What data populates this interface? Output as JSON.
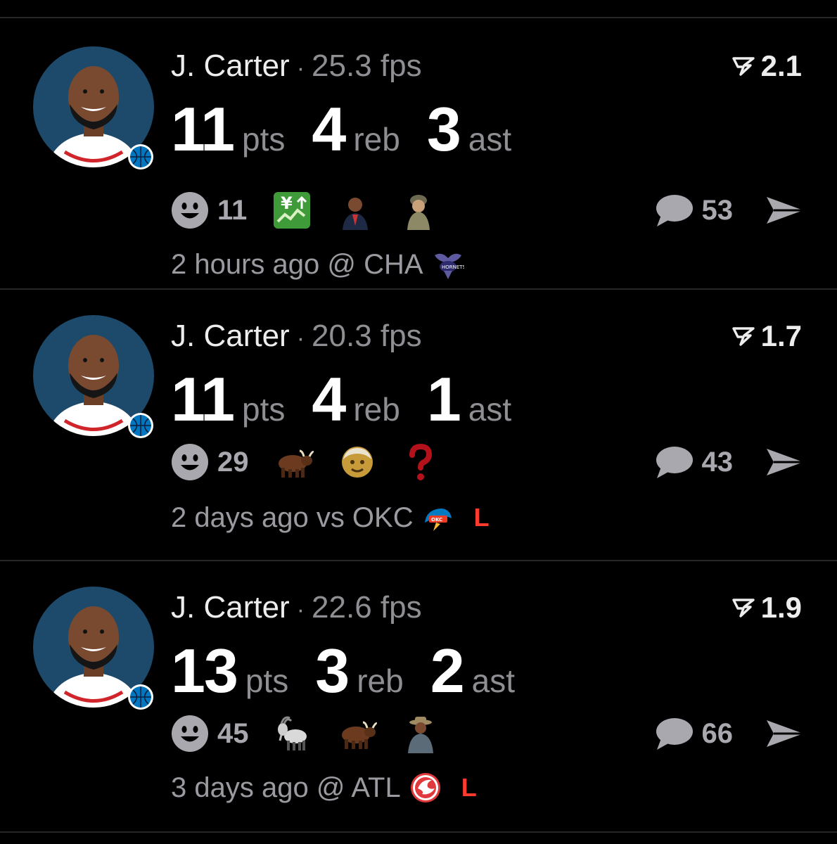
{
  "posts": [
    {
      "player": "J. Carter",
      "separator": "·",
      "fps": "25.3 fps",
      "rating": "2.1",
      "stats": [
        {
          "value": "11",
          "unit": "pts"
        },
        {
          "value": "4",
          "unit": "reb"
        },
        {
          "value": "3",
          "unit": "ast"
        }
      ],
      "reaction_count": "11",
      "reactions": [
        "yen-chart-emoji",
        "person-in-suit-emoji",
        "soldier-emoji"
      ],
      "comment_count": "53",
      "time": "2 hours ago @ CHA",
      "opponent_logo": "hornets-logo",
      "result": ""
    },
    {
      "player": "J. Carter",
      "separator": "·",
      "fps": "20.3 fps",
      "rating": "1.7",
      "stats": [
        {
          "value": "11",
          "unit": "pts"
        },
        {
          "value": "4",
          "unit": "reb"
        },
        {
          "value": "1",
          "unit": "ast"
        }
      ],
      "reaction_count": "29",
      "reactions": [
        "ox-emoji",
        "older-person-emoji",
        "question-mark-emoji"
      ],
      "comment_count": "43",
      "time": "2 days ago vs OKC",
      "opponent_logo": "thunder-logo",
      "result": "L"
    },
    {
      "player": "J. Carter",
      "separator": "·",
      "fps": "22.6 fps",
      "rating": "1.9",
      "stats": [
        {
          "value": "13",
          "unit": "pts"
        },
        {
          "value": "3",
          "unit": "reb"
        },
        {
          "value": "2",
          "unit": "ast"
        }
      ],
      "reaction_count": "45",
      "reactions": [
        "goat-emoji",
        "ox-emoji",
        "cowboy-figure-emoji"
      ],
      "comment_count": "66",
      "time": "3 days ago @ ATL",
      "opponent_logo": "hawks-logo",
      "result": "L"
    }
  ]
}
